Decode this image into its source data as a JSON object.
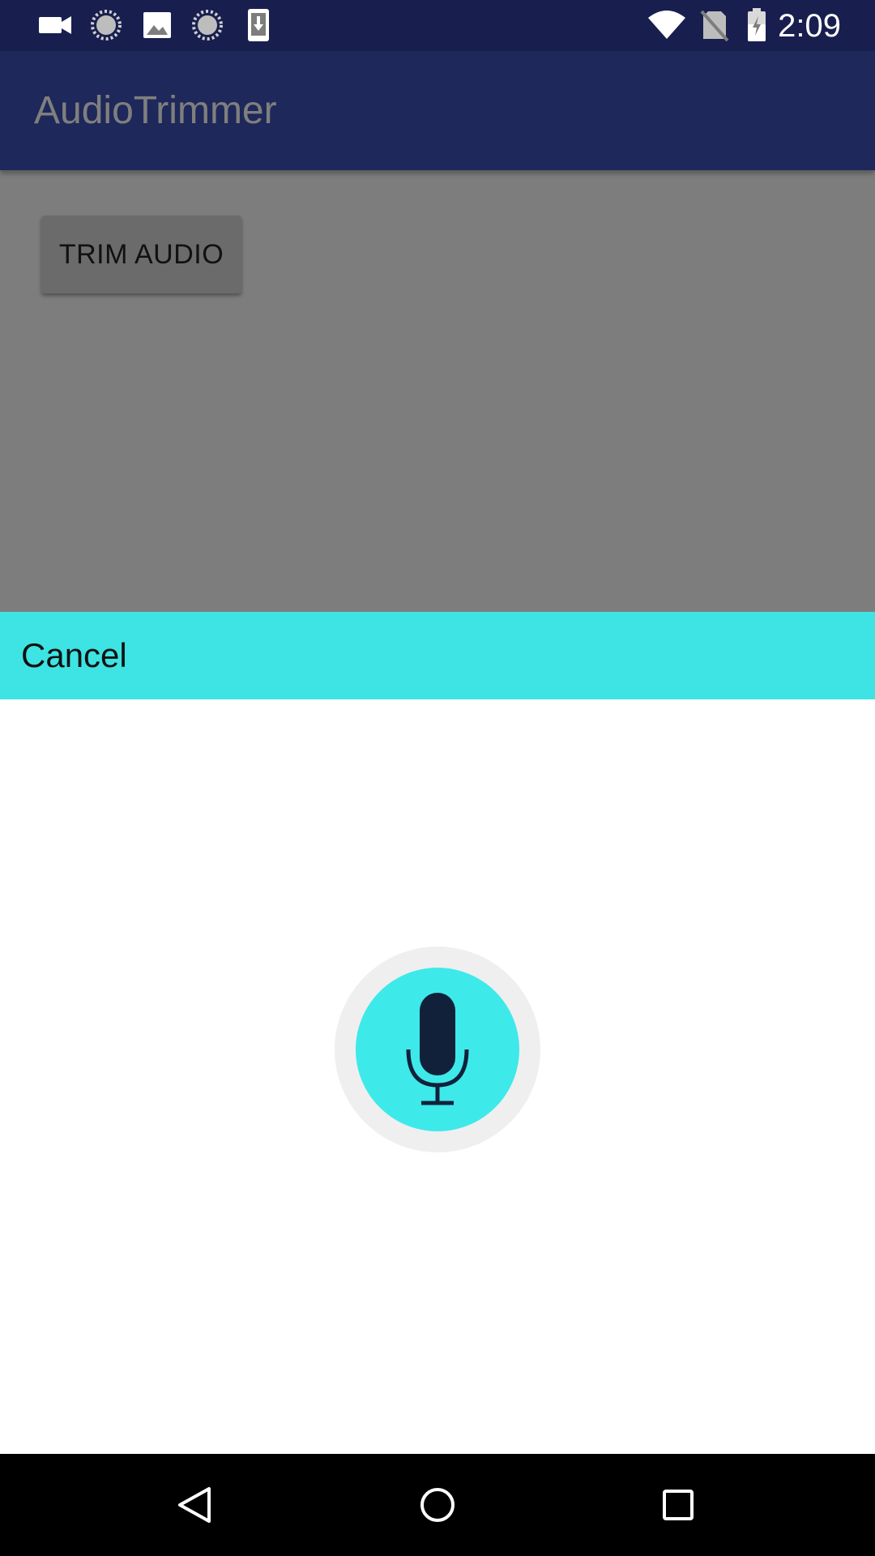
{
  "status_bar": {
    "time": "2:09",
    "left_icons": [
      "video-camera-icon",
      "loading-icon",
      "image-icon",
      "loading-icon",
      "download-icon"
    ],
    "right_icons": [
      "wifi-icon",
      "no-sim-icon",
      "battery-icon"
    ]
  },
  "app_bar": {
    "title": "AudioTrimmer",
    "color": "#3f51b5"
  },
  "main": {
    "trim_button_label": "TRIM AUDIO"
  },
  "sheet": {
    "cancel_label": "Cancel",
    "header_color": "#3ee3e3",
    "mic_icon": "microphone-icon"
  },
  "nav_bar": {
    "buttons": [
      "back-icon",
      "home-icon",
      "recents-icon"
    ]
  }
}
